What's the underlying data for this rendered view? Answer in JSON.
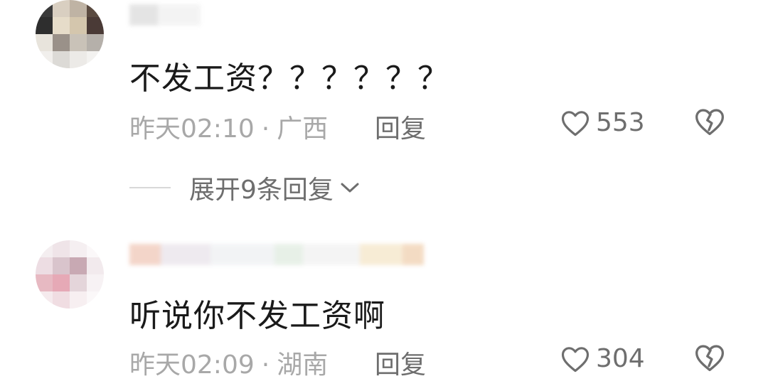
{
  "comments": [
    {
      "text": "不发工资？？？？？？",
      "time": "昨天02:10",
      "location": "广西",
      "reply_label": "回复",
      "likes": "553",
      "expand_label": "展开9条回复"
    },
    {
      "text": "听说你不发工资啊",
      "time": "昨天02:09",
      "location": "湖南",
      "reply_label": "回复",
      "likes": "304"
    }
  ],
  "separator": "·",
  "icons": {
    "like": "heart-outline-icon",
    "dislike": "broken-heart-icon",
    "expand": "chevron-down-icon"
  },
  "colors": {
    "text": "#1a1a1a",
    "meta": "#a8a8a8",
    "action": "#6e6e6e"
  }
}
